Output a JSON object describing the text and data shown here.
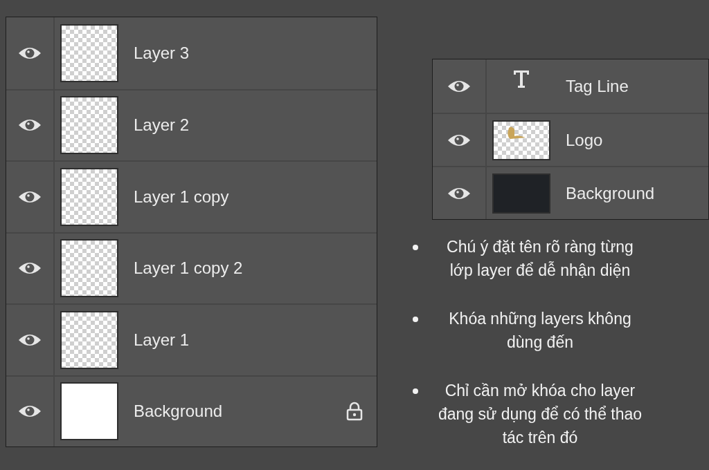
{
  "layers_panel": [
    {
      "name": "Layer 3",
      "kind": "transparent",
      "visible": true,
      "locked": false
    },
    {
      "name": "Layer 2",
      "kind": "transparent",
      "visible": true,
      "locked": false
    },
    {
      "name": "Layer 1 copy",
      "kind": "transparent",
      "visible": true,
      "locked": false
    },
    {
      "name": "Layer 1 copy 2",
      "kind": "transparent",
      "visible": true,
      "locked": false
    },
    {
      "name": "Layer 1",
      "kind": "transparent",
      "visible": true,
      "locked": false
    },
    {
      "name": "Background",
      "kind": "white",
      "visible": true,
      "locked": true
    }
  ],
  "example_panel": [
    {
      "name": "Tag Line",
      "kind": "text",
      "visible": true,
      "locked": false
    },
    {
      "name": "Logo",
      "kind": "logo",
      "visible": true,
      "locked": false
    },
    {
      "name": "Background",
      "kind": "dark",
      "visible": true,
      "locked": false
    }
  ],
  "tips": [
    "Chú ý đặt tên rõ ràng từng lớp layer để dễ nhận diện",
    "Khóa những layers không dùng đến",
    "Chỉ cần mở khóa cho layer đang sử dụng để có thể thao tác trên đó"
  ]
}
